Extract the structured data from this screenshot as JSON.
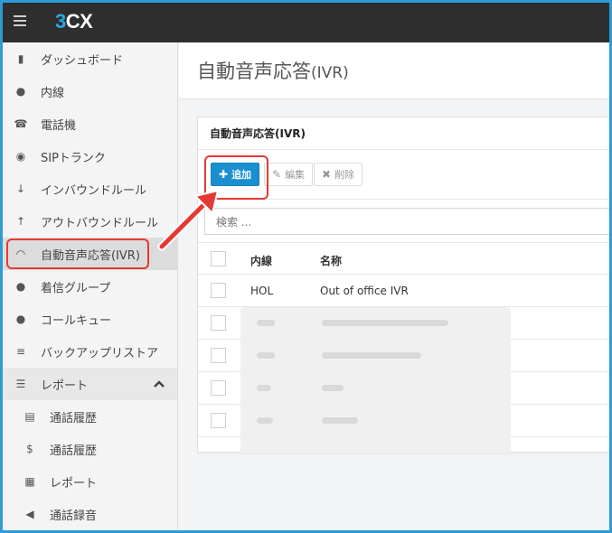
{
  "app": {
    "logo_number": "3",
    "logo_text": "CX"
  },
  "sidebar": {
    "items": [
      {
        "icon": "bar-chart-icon",
        "glyph": "▮",
        "label": "ダッシュボード"
      },
      {
        "icon": "user-icon",
        "glyph": "●",
        "label": "内線"
      },
      {
        "icon": "phone-icon",
        "glyph": "☎",
        "label": "電話機"
      },
      {
        "icon": "globe-icon",
        "glyph": "◉",
        "label": "SIPトランク"
      },
      {
        "icon": "arrow-down-icon",
        "glyph": "↓",
        "label": "インバウンドルール"
      },
      {
        "icon": "arrow-up-icon",
        "glyph": "↑",
        "label": "アウトバウンドルール"
      },
      {
        "icon": "headset-icon",
        "glyph": "◠",
        "label": "自動音声応答(IVR)"
      },
      {
        "icon": "group-icon",
        "glyph": "●",
        "label": "着信グループ"
      },
      {
        "icon": "users-icon",
        "glyph": "●",
        "label": "コールキュー"
      },
      {
        "icon": "database-icon",
        "glyph": "≡",
        "label": "バックアップリストア"
      },
      {
        "icon": "list-icon",
        "glyph": "☰",
        "label": "レポート"
      },
      {
        "icon": "document-icon",
        "glyph": "▤",
        "label": "通話履歴"
      },
      {
        "icon": "dollar-icon",
        "glyph": "$",
        "label": "通話履歴"
      },
      {
        "icon": "report-icon",
        "glyph": "▦",
        "label": "レポート"
      },
      {
        "icon": "speaker-icon",
        "glyph": "◀",
        "label": "通話録音"
      }
    ]
  },
  "page": {
    "title": "自動音声応答",
    "title_suffix": "(IVR)"
  },
  "panel": {
    "title": "自動音声応答(IVR)",
    "toolbar": {
      "add": "追加",
      "edit": "編集",
      "delete": "削除"
    },
    "search_placeholder": "検索 ...",
    "columns": {
      "ext": "内線",
      "name": "名称"
    },
    "rows": [
      {
        "ext": "HOL",
        "name": "Out of office IVR"
      }
    ]
  }
}
